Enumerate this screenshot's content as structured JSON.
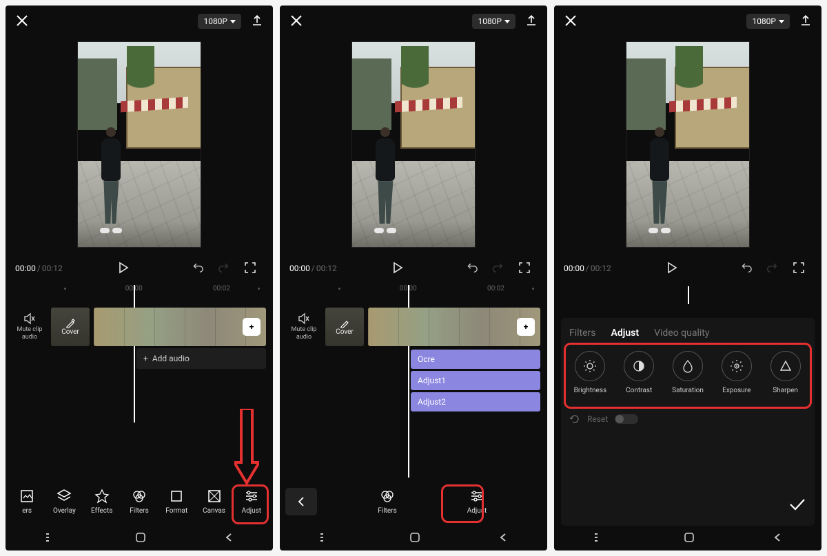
{
  "resolution_label": "1080P",
  "time": {
    "current": "00:00",
    "duration": "00:12"
  },
  "ruler": {
    "t1": "00:00",
    "t2": "00:02"
  },
  "mute_label_line1": "Mute clip",
  "mute_label_line2": "audio",
  "cover_label": "Cover",
  "add_audio_label": "Add audio",
  "toolbar1": {
    "stickers": "ers",
    "overlay": "Overlay",
    "effects": "Effects",
    "filters": "Filters",
    "format": "Format",
    "canvas": "Canvas",
    "adjust": "Adjust"
  },
  "panel2_layers": [
    "Ocre",
    "Adjust1",
    "Adjust2"
  ],
  "toolbar2": {
    "filters": "Filters",
    "adjust": "Adjust"
  },
  "sheet": {
    "tabs": {
      "filters": "Filters",
      "adjust": "Adjust",
      "quality": "Video quality"
    },
    "adjustments": {
      "brightness": "Brightness",
      "contrast": "Contrast",
      "saturation": "Saturation",
      "exposure": "Exposure",
      "sharpen": "Sharpen"
    },
    "reset": "Reset"
  }
}
